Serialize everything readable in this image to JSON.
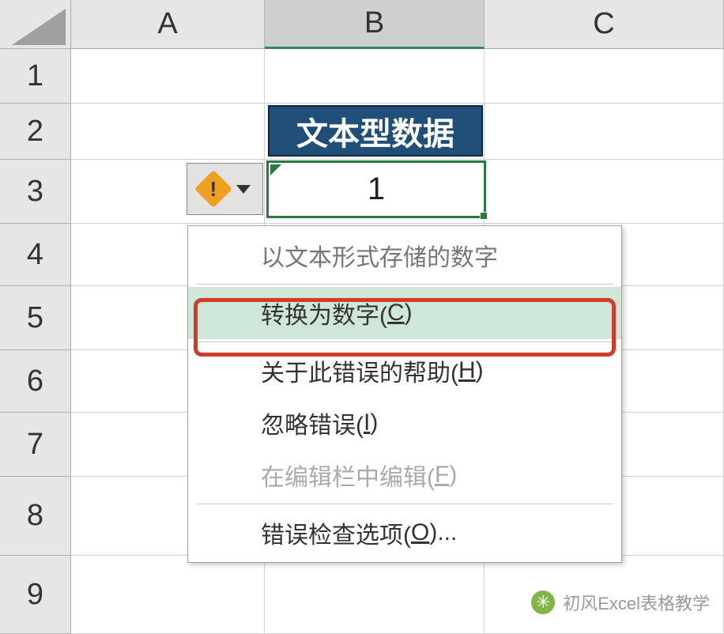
{
  "columns": {
    "A": "A",
    "B": "B",
    "C": "C"
  },
  "rows": {
    "1": "1",
    "2": "2",
    "3": "3",
    "4": "4",
    "5": "5",
    "6": "6",
    "7": "7",
    "8": "8",
    "9": "9"
  },
  "header_cell": "文本型数据",
  "selected_cell_value": "1",
  "error_button": {
    "mark": "!",
    "aria": "error-check-dropdown"
  },
  "context_menu": {
    "title": "以文本形式存储的数字",
    "items": [
      {
        "label": "转换为数字(",
        "key": "C",
        "suffix": ")",
        "highlighted": true
      },
      {
        "label": "关于此错误的帮助(",
        "key": "H",
        "suffix": ")"
      },
      {
        "label": "忽略错误(",
        "key": "I",
        "suffix": ")"
      },
      {
        "label": "在编辑栏中编辑(",
        "key": "F",
        "suffix": ")",
        "disabled": true
      },
      {
        "label": "错误检查选项(",
        "key": "O",
        "suffix": ")..."
      }
    ]
  },
  "watermark": "初风Excel表格教学"
}
